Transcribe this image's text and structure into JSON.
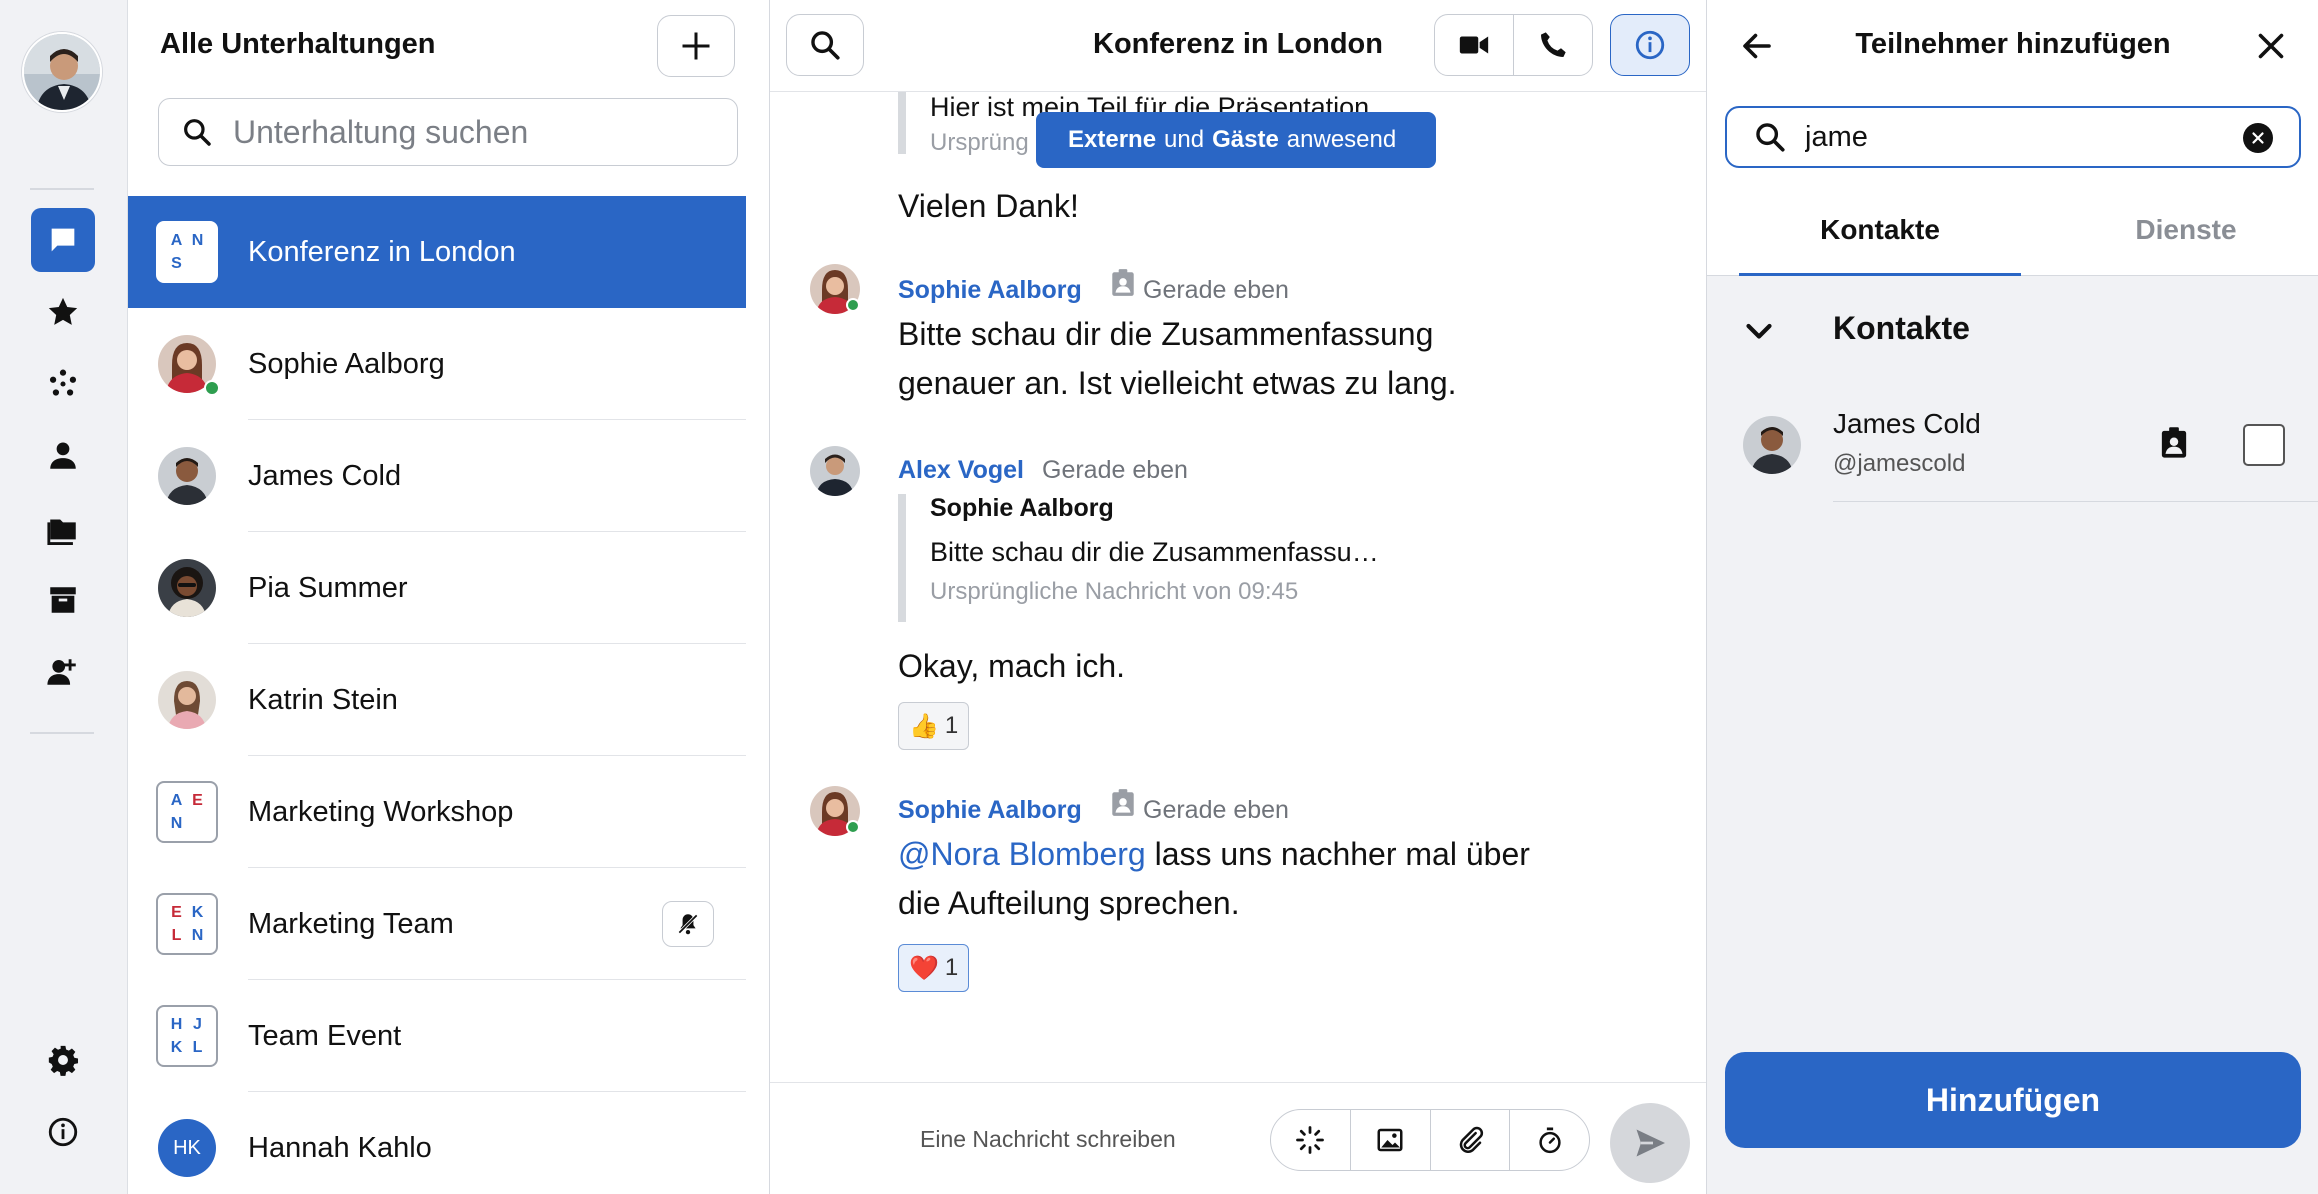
{
  "rail": {
    "items": [
      "chats-icon",
      "favorites-icon",
      "channels-icon",
      "contacts-icon",
      "files-icon",
      "archive-icon",
      "invite-user-icon",
      "settings-icon",
      "info-icon"
    ],
    "accent": "#2a66c5"
  },
  "list": {
    "title": "Alle Unterhaltungen",
    "search_placeholder": "Unterhaltung suchen",
    "conversations": [
      {
        "name": "Konferenz in London",
        "type": "group",
        "letters": [
          "A",
          "N",
          "S",
          ""
        ],
        "active": true
      },
      {
        "name": "Sophie Aalborg",
        "type": "person",
        "online": true
      },
      {
        "name": "James Cold",
        "type": "person"
      },
      {
        "name": "Pia Summer",
        "type": "person"
      },
      {
        "name": "Katrin Stein",
        "type": "person"
      },
      {
        "name": "Marketing Workshop",
        "type": "group",
        "letters": [
          "A",
          "E",
          "N",
          ""
        ]
      },
      {
        "name": "Marketing Team",
        "type": "group",
        "letters": [
          "E",
          "K",
          "L",
          "N"
        ],
        "muted": true
      },
      {
        "name": "Team Event",
        "type": "group",
        "letters": [
          "H",
          "J",
          "K",
          "L"
        ]
      },
      {
        "name": "Hannah Kahlo",
        "type": "initials",
        "initials": "HK"
      }
    ]
  },
  "chat": {
    "title": "Konferenz in London",
    "banner": {
      "part1": "Externe",
      "part2": "und",
      "part3": "Gäste",
      "part4": "anwesend"
    },
    "top_quote": {
      "text": "Hier ist mein Teil für die Präsentation",
      "meta": "Ursprüng"
    },
    "top_message": "Vielen Dank!",
    "messages": [
      {
        "sender": "Sophie Aalborg",
        "time": "Gerade eben",
        "line1": "Bitte schau dir die Zusammenfassung",
        "line2": "genauer an. Ist vielleicht etwas zu lang."
      },
      {
        "sender": "Alex Vogel",
        "time": "Gerade eben",
        "quote_author": "Sophie Aalborg",
        "quote_text": "Bitte schau dir die Zusammenfassu…",
        "quote_meta": "Ursprüngliche Nachricht von 09:45",
        "text": "Okay, mach ich.",
        "reaction_emoji": "👍",
        "reaction_count": "1"
      },
      {
        "sender": "Sophie Aalborg",
        "time": "Gerade eben",
        "mention": "@Nora Blomberg",
        "line1_rest": " lass uns nachher mal über",
        "line2": "die Aufteilung sprechen.",
        "reaction_emoji": "❤️",
        "reaction_count": "1"
      }
    ],
    "composer_placeholder": "Eine Nachricht schreiben"
  },
  "panel": {
    "title": "Teilnehmer hinzufügen",
    "search_value": "jame",
    "tabs": [
      "Kontakte",
      "Dienste"
    ],
    "section_title": "Kontakte",
    "contact": {
      "name": "James Cold",
      "handle": "@jamescold"
    },
    "add_button": "Hinzufügen"
  }
}
